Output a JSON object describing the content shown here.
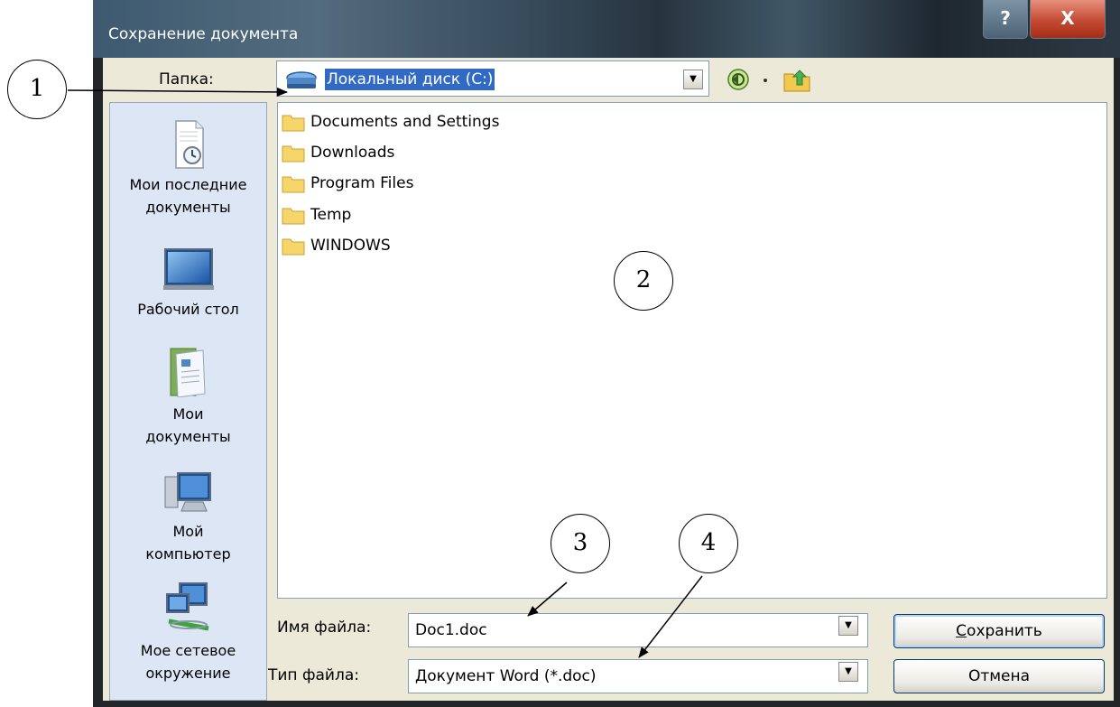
{
  "window": {
    "title": "Сохранение документа",
    "help_label": "?",
    "close_label": "X"
  },
  "toolbar": {
    "folder_label": "Папка:",
    "current_folder": "Локальный диск (C:)",
    "dropdown_arrow": "▼"
  },
  "places": [
    {
      "label": "Мои последние документы",
      "icon": "recent-documents-icon"
    },
    {
      "label": "Рабочий стол",
      "icon": "desktop-icon"
    },
    {
      "label": "Мои документы",
      "icon": "my-documents-icon"
    },
    {
      "label": "Мой компьютер",
      "icon": "my-computer-icon"
    },
    {
      "label": "Мое сетевое окружение",
      "icon": "network-places-icon"
    }
  ],
  "files": [
    {
      "name": "Documents and Settings",
      "icon": "folder-icon"
    },
    {
      "name": "Downloads",
      "icon": "folder-icon"
    },
    {
      "name": "Program Files",
      "icon": "folder-icon"
    },
    {
      "name": "Temp",
      "icon": "folder-icon"
    },
    {
      "name": "WINDOWS",
      "icon": "folder-icon"
    }
  ],
  "bottom": {
    "filename_label": "Имя файла:",
    "filename_value": "Doc1.doc",
    "filetype_label": "Тип файла:",
    "filetype_value": "Документ Word (*.doc)",
    "save_accel": "С",
    "save_rest": "охранить",
    "cancel_label": "Отмена"
  },
  "callouts": {
    "c1": "1",
    "c2": "2",
    "c3": "3",
    "c4": "4"
  },
  "colors": {
    "selection": "#316ac5",
    "dialog_bg": "#ece9d8",
    "places_bg": "#dce6f5",
    "frame": "#232629"
  }
}
